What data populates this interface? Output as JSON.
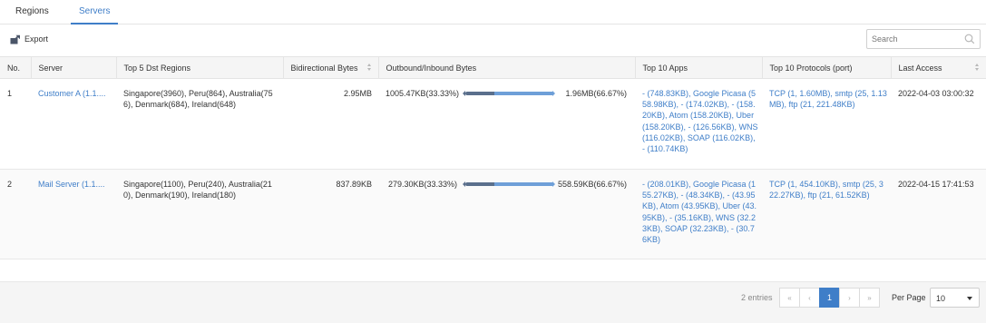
{
  "tabs": [
    {
      "label": "Regions",
      "active": false
    },
    {
      "label": "Servers",
      "active": true
    }
  ],
  "toolbar": {
    "export_label": "Export",
    "search_placeholder": "Search",
    "search_value": ""
  },
  "table": {
    "columns": [
      "No.",
      "Server",
      "Top 5 Dst Regions",
      "Bidirectional Bytes",
      "Outbound/Inbound Bytes",
      "Top 10 Apps",
      "Top 10 Protocols (port)",
      "Last Access"
    ],
    "rows": [
      {
        "no": "1",
        "server": "Customer A (1.1....",
        "regions": "Singapore(3960), Peru(864), Australia(756), Denmark(684), Ireland(648)",
        "bidirectional": "2.95MB",
        "outbound": "1005.47KB(33.33%)",
        "inbound": "1.96MB(66.67%)",
        "outbound_share": 0.3333,
        "apps": "- (748.83KB), Google Picasa (558.98KB), - (174.02KB), - (158.20KB), Atom (158.20KB), Uber (158.20KB), - (126.56KB), WNS (116.02KB), SOAP (116.02KB), - (110.74KB)",
        "protocols": "TCP (1, 1.60MB), smtp (25, 1.13MB), ftp (21, 221.48KB)",
        "last_access": "2022-04-03 03:00:32"
      },
      {
        "no": "2",
        "server": "Mail Server (1.1....",
        "regions": "Singapore(1100), Peru(240), Australia(210), Denmark(190), Ireland(180)",
        "bidirectional": "837.89KB",
        "outbound": "279.30KB(33.33%)",
        "inbound": "558.59KB(66.67%)",
        "outbound_share": 0.3333,
        "apps": "- (208.01KB), Google Picasa (155.27KB), - (48.34KB), - (43.95KB), Atom (43.95KB), Uber (43.95KB), - (35.16KB), WNS (32.23KB), SOAP (32.23KB), - (30.76KB)",
        "protocols": "TCP (1, 454.10KB), smtp (25, 322.27KB), ftp (21, 61.52KB)",
        "last_access": "2022-04-15 17:41:53"
      }
    ]
  },
  "footer": {
    "entries_text": "2 entries",
    "pager": {
      "first": "«",
      "prev": "‹",
      "current_page": "1",
      "next": "›",
      "last": "»"
    },
    "per_page_label": "Per Page",
    "per_page_value": "10"
  },
  "colors": {
    "accent": "#3f7ec8",
    "bar_outbound": "#5a6f8c",
    "bar_inbound": "#6e9fd8",
    "header_bg": "#f5f5f5"
  },
  "icons": {
    "export": "export-icon",
    "search": "search-icon",
    "sort": "sort-icon",
    "dropdown": "chevron-down-icon"
  }
}
